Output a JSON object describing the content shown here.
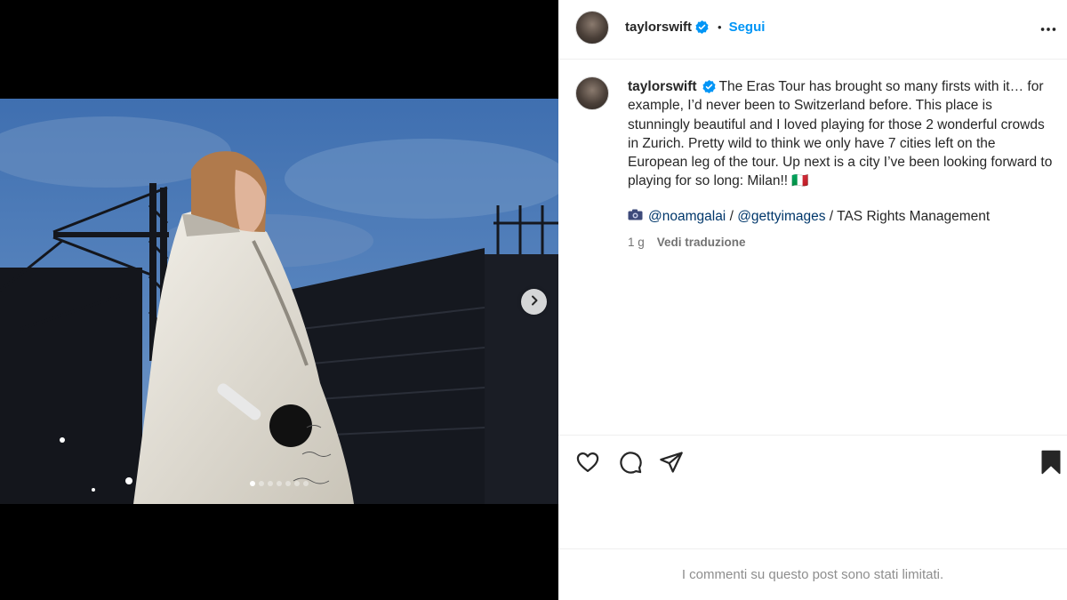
{
  "post": {
    "username": "taylorswift",
    "follow_label": "Segui",
    "separator": "•",
    "caption": "The Eras Tour has brought so many firsts with it… for example, I’d never been to Switzerland before. This place is stunningly beautiful and I loved playing for those 2 wonderful crowds in Zurich. Pretty wild to think we only have 7 cities left on the European leg of the tour. Up next is a city I’ve been looking forward to playing for so long: Milan!! 🇮🇹",
    "credits": {
      "camera_icon": "camera-icon",
      "mention1": "@noamgalai",
      "sep1": " / ",
      "mention2": "@gettyimages",
      "rest": " / TAS Rights Management"
    },
    "time_ago": "1 g",
    "translate_label": "Vedi traduzione",
    "comments_limited": "I commenti su questo post sono stati limitati."
  },
  "carousel": {
    "dot_count": 7,
    "active_index": 0
  },
  "icons": {
    "like": "heart-icon",
    "comment": "comment-icon",
    "share": "share-icon",
    "save": "bookmark-icon",
    "more": "more-icon",
    "verified": "verified-badge-icon",
    "next": "chevron-right-icon"
  },
  "colors": {
    "accent": "#0095f6",
    "link": "#00376b",
    "verified": "#0095f6",
    "muted": "#737373"
  }
}
